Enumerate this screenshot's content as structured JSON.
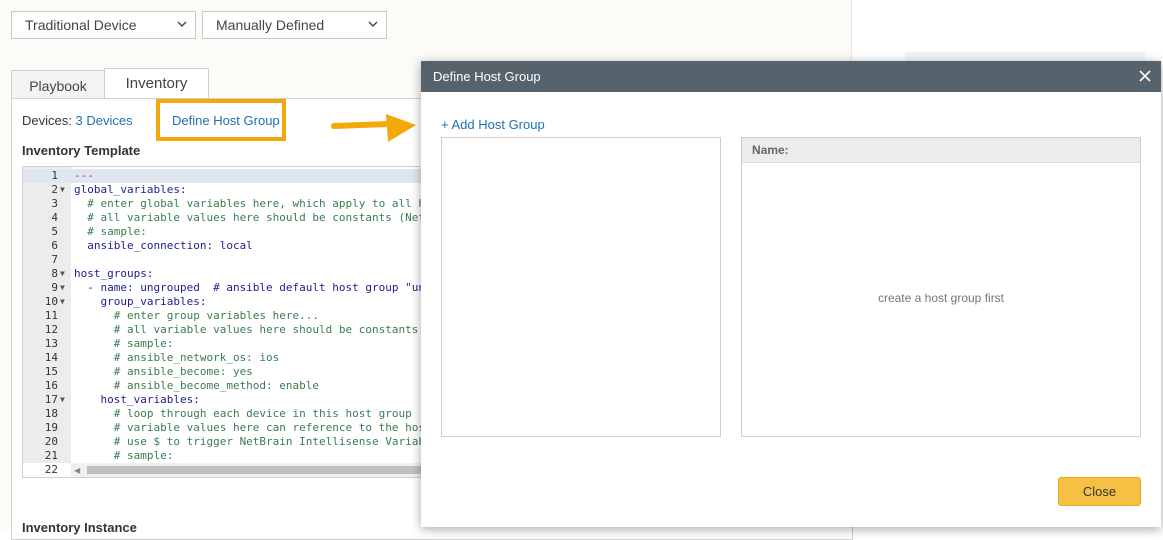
{
  "selectors": {
    "device_type": "Traditional Device",
    "definition_mode": "Manually Defined"
  },
  "tabs": [
    {
      "label": "Playbook",
      "active": false
    },
    {
      "label": "Inventory",
      "active": true
    }
  ],
  "inventory": {
    "devices_label": "Devices:",
    "devices_link": "3 Devices",
    "define_host_group": "Define Host Group",
    "template_heading": "Inventory Template",
    "instance_heading": "Inventory Instance"
  },
  "editor": {
    "lines": [
      {
        "n": "1",
        "fold": false,
        "text": "---"
      },
      {
        "n": "2",
        "fold": true,
        "text": "global_variables:"
      },
      {
        "n": "3",
        "fold": false,
        "text": "  # enter global variables here, which apply to all h"
      },
      {
        "n": "4",
        "fold": false,
        "text": "  # all variable values here should be constants (Net"
      },
      {
        "n": "5",
        "fold": false,
        "text": "  # sample:"
      },
      {
        "n": "6",
        "fold": false,
        "text": "  ansible_connection: local"
      },
      {
        "n": "7",
        "fold": false,
        "text": ""
      },
      {
        "n": "8",
        "fold": true,
        "text": "host_groups:"
      },
      {
        "n": "9",
        "fold": true,
        "text": "  - name: ungrouped  # ansible default host group \"un"
      },
      {
        "n": "10",
        "fold": true,
        "text": "    group_variables:"
      },
      {
        "n": "11",
        "fold": false,
        "text": "      # enter group variables here..."
      },
      {
        "n": "12",
        "fold": false,
        "text": "      # all variable values here should be constants"
      },
      {
        "n": "13",
        "fold": false,
        "text": "      # sample:"
      },
      {
        "n": "14",
        "fold": false,
        "text": "      # ansible_network_os: ios"
      },
      {
        "n": "15",
        "fold": false,
        "text": "      # ansible_become: yes"
      },
      {
        "n": "16",
        "fold": false,
        "text": "      # ansible_become_method: enable"
      },
      {
        "n": "17",
        "fold": true,
        "text": "    host_variables:"
      },
      {
        "n": "18",
        "fold": false,
        "text": "      # loop through each device in this host group"
      },
      {
        "n": "19",
        "fold": false,
        "text": "      # variable values here can reference to the hos"
      },
      {
        "n": "20",
        "fold": false,
        "text": "      # use $ to trigger NetBrain Intellisense Variab"
      },
      {
        "n": "21",
        "fold": false,
        "text": "      # sample:"
      },
      {
        "n": "22",
        "fold": false,
        "text": ""
      }
    ]
  },
  "modal": {
    "title": "Define Host Group",
    "add_link": "+ Add Host Group",
    "name_header": "Name:",
    "empty_message": "create a host group first",
    "close_button": "Close"
  },
  "colors": {
    "highlight": "#f3a90a",
    "modal_header": "#56636d",
    "primary_button": "#f6c143",
    "link": "#1f6fb4"
  }
}
